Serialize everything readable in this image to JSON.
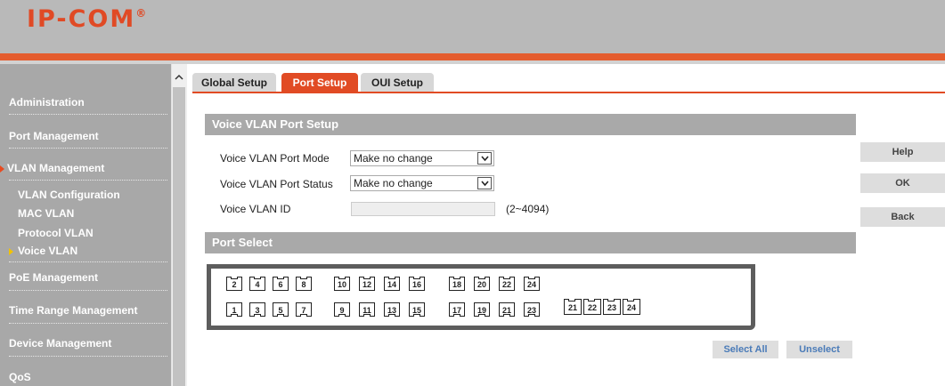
{
  "brand": {
    "logo": "IP-COM",
    "reg": "®"
  },
  "sidebar": {
    "items": [
      {
        "label": "Administration"
      },
      {
        "label": "Port Management"
      },
      {
        "label": "VLAN Management"
      },
      {
        "label": "PoE Management"
      },
      {
        "label": "Time Range Management"
      },
      {
        "label": "Device Management"
      },
      {
        "label": "QoS"
      }
    ],
    "subitems": [
      {
        "label": "VLAN Configuration"
      },
      {
        "label": "MAC VLAN"
      },
      {
        "label": "Protocol VLAN"
      },
      {
        "label": "Voice VLAN"
      }
    ]
  },
  "tabs": [
    {
      "label": "Global Setup"
    },
    {
      "label": "Port Setup"
    },
    {
      "label": "OUI Setup"
    }
  ],
  "voice": {
    "title": "Voice VLAN Port Setup",
    "mode_label": "Voice VLAN Port Mode",
    "mode_value": "Make no change",
    "status_label": "Voice VLAN Port Status",
    "status_value": "Make no change",
    "id_label": "Voice VLAN ID",
    "id_value": "",
    "id_range": "(2~4094)"
  },
  "port_select": {
    "title": "Port Select",
    "top_row": [
      "2",
      "4",
      "6",
      "8",
      "10",
      "12",
      "14",
      "16",
      "18",
      "20",
      "22",
      "24"
    ],
    "bottom_row": [
      "1",
      "3",
      "5",
      "7",
      "9",
      "11",
      "13",
      "15",
      "17",
      "19",
      "21",
      "23"
    ],
    "extra_row": [
      "21",
      "22",
      "23",
      "24"
    ],
    "select_all": "Select All",
    "unselect": "Unselect"
  },
  "buttons": {
    "help": "Help",
    "ok": "OK",
    "back": "Back"
  }
}
